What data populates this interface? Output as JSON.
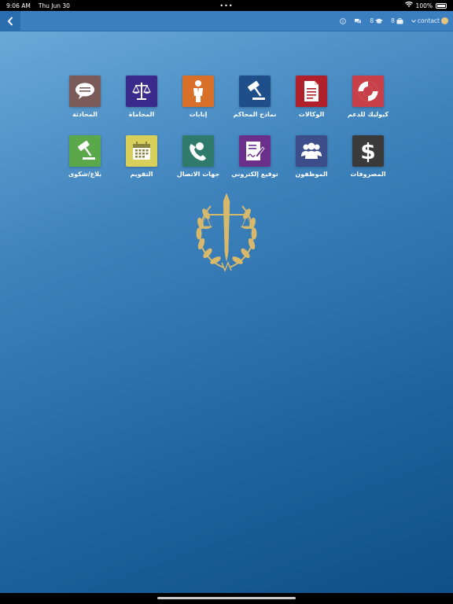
{
  "status": {
    "time": "9:06 AM",
    "date": "Thu Jun 30",
    "dots": "•••",
    "battery": "100%"
  },
  "toolbar": {
    "back_icon": "chevron-left-icon",
    "info_icon": "info-icon",
    "chat_icon": "chat-icon",
    "count_1": "8",
    "count_2": "8",
    "contact_label": "contact"
  },
  "tiles_row1": [
    {
      "label": "المحادثة",
      "icon": "chat-bubble-icon",
      "color": "#7b5a5a"
    },
    {
      "label": "المحاماة",
      "icon": "scales-icon",
      "color": "#3a2a8c"
    },
    {
      "label": "إنابات",
      "icon": "person-icon",
      "color": "#d9702a"
    },
    {
      "label": "نماذج المحاكم",
      "icon": "gavel-icon",
      "color": "#1f4f8a"
    },
    {
      "label": "الوكالات",
      "icon": "document-icon",
      "color": "#b0202a"
    },
    {
      "label": "كيوليك للدعم",
      "icon": "lifebuoy-icon",
      "color": "#c8404a"
    }
  ],
  "tiles_row2": [
    {
      "label": "بلاغ/شكوى",
      "icon": "gavel-icon",
      "color": "#5aa84a"
    },
    {
      "label": "التقويم",
      "icon": "calendar-icon",
      "color": "#d8d05a"
    },
    {
      "label": "جهات الاتصال",
      "icon": "phone-contact-icon",
      "color": "#2f7a6a"
    },
    {
      "label": "توقيع إلكتروني",
      "icon": "signature-icon",
      "color": "#6a2f8a"
    },
    {
      "label": "الموظفون",
      "icon": "people-icon",
      "color": "#3d4d8a"
    },
    {
      "label": "المصروفات",
      "icon": "dollar-icon",
      "color": "#3a3a3a"
    }
  ],
  "logo": {
    "icon": "justice-laurel-logo",
    "color": "#d8b86a"
  }
}
